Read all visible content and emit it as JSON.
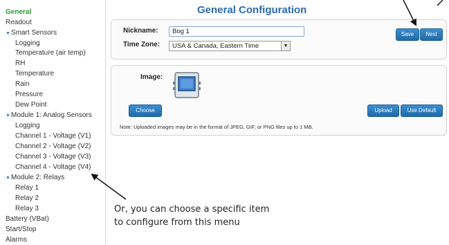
{
  "sidebar": {
    "items": [
      {
        "label": "General",
        "expand": ""
      },
      {
        "label": "Readout",
        "expand": ""
      },
      {
        "label": "Smart Sensors",
        "expand": "▼"
      },
      {
        "label": "Logging",
        "expand": ""
      },
      {
        "label": "Temperature (air temp)",
        "expand": ""
      },
      {
        "label": "RH",
        "expand": ""
      },
      {
        "label": "Temperature",
        "expand": ""
      },
      {
        "label": "Rain",
        "expand": ""
      },
      {
        "label": "Pressure",
        "expand": ""
      },
      {
        "label": "Dew Point",
        "expand": ""
      },
      {
        "label": "Module 1: Analog Sensors",
        "expand": "▼"
      },
      {
        "label": "Logging",
        "expand": ""
      },
      {
        "label": "Channel 1 - Voltage (V1)",
        "expand": ""
      },
      {
        "label": "Channel 2 - Voltage (V2)",
        "expand": ""
      },
      {
        "label": "Channel 3 - Voltage (V3)",
        "expand": ""
      },
      {
        "label": "Channel 4 - Voltage (V4)",
        "expand": ""
      },
      {
        "label": "Module 2: Relays",
        "expand": "▼"
      },
      {
        "label": "Relay 1",
        "expand": ""
      },
      {
        "label": "Relay 2",
        "expand": ""
      },
      {
        "label": "Relay 3",
        "expand": ""
      },
      {
        "label": "Battery (VBat)",
        "expand": ""
      },
      {
        "label": "Start/Stop",
        "expand": ""
      },
      {
        "label": "Alarms",
        "expand": ""
      }
    ]
  },
  "header": {
    "title": "General Configuration"
  },
  "config": {
    "nickname_label": "Nickname:",
    "nickname_value": "Bog 1",
    "timezone_label": "Time Zone:",
    "timezone_value": "USA & Canada, Eastern Time",
    "save_label": "Save",
    "next_label": "Next"
  },
  "image_panel": {
    "image_label": "Image:",
    "choose_label": "Choose",
    "upload_label": "Upload",
    "use_default_label": "Use Default",
    "note": "Note: Uploaded images may be in the format of JPEG, GIF, or PNG files up to 1 MB."
  },
  "annotation": {
    "line1": "Or, you can choose a specific item",
    "line2": "to configure from this menu"
  },
  "colors": {
    "accent": "#2b6cb0",
    "active": "#2a9d3a",
    "button": "#2a7bbd"
  }
}
